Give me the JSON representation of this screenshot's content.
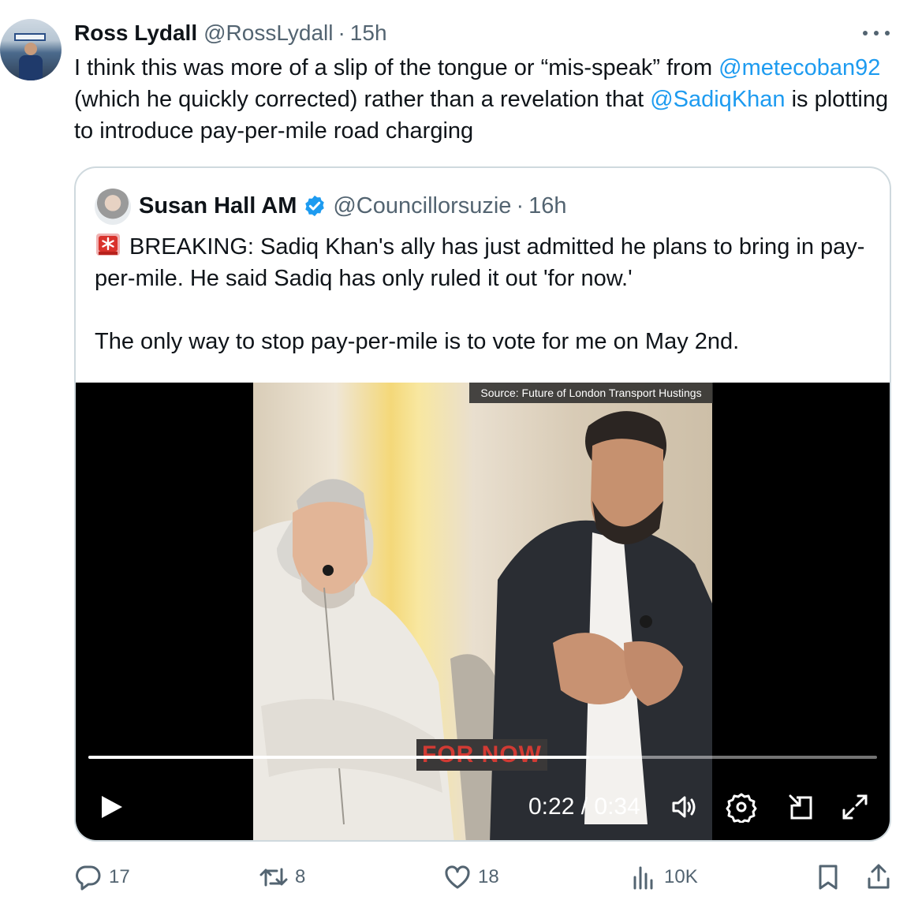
{
  "tweet": {
    "author_name": "Ross Lydall",
    "author_handle": "@RossLydall",
    "separator": "·",
    "time": "15h",
    "text": {
      "part1": "I think this was more of a slip of the tongue or “mis-speak” from ",
      "mention1": "@metecoban92",
      "part2": " (which he quickly corrected) rather than a revelation that ",
      "mention2": "@SadiqKhan",
      "part3": " is plotting to introduce pay-per-mile road charging"
    }
  },
  "quote": {
    "author_name": "Susan Hall AM",
    "author_handle": "@Councillorsuzie",
    "separator": "·",
    "time": "16h",
    "verified": true,
    "text_line1": "BREAKING: Sadiq Khan's ally has just admitted he plans to bring in pay-per-mile. He said Sadiq has only ruled it out 'for now.'",
    "text_line2": "The only way to stop pay-per-mile is to vote for me on May 2nd.",
    "emoji": "rotating-light-icon"
  },
  "video": {
    "source_label": "Source: Future of London Transport Hustings",
    "caption": "FOR NOW",
    "timecode": "0:22 / 0:34",
    "progress": 0.635,
    "controls": [
      "play-icon",
      "volume-icon",
      "settings-icon",
      "picture-in-picture-icon",
      "fullscreen-icon"
    ]
  },
  "actions": {
    "replies": "17",
    "reposts": "8",
    "likes": "18",
    "views": "10K"
  },
  "colors": {
    "accent": "#1d9bf0",
    "text": "#0f1419",
    "muted": "#536471",
    "border": "#cfd9de",
    "caption_red": "#d23a33"
  }
}
